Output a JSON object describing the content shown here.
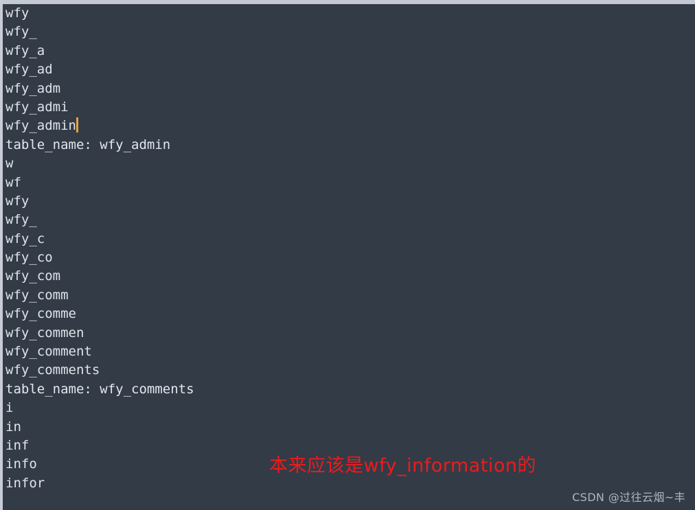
{
  "window": {
    "background_color": "#333b47",
    "chrome_color": "#c5c9d4",
    "text_color": "#dfe4ea",
    "caret_color": "#e8a33d",
    "annotation_color": "#ec1c1c",
    "watermark_color": "#aeb6c2"
  },
  "terminal": {
    "lines": [
      {
        "text": "wfy",
        "kind": "typed"
      },
      {
        "text": "wfy_",
        "kind": "typed"
      },
      {
        "text": "wfy_a",
        "kind": "typed"
      },
      {
        "text": "wfy_ad",
        "kind": "typed"
      },
      {
        "text": "wfy_adm",
        "kind": "typed"
      },
      {
        "text": "wfy_admi",
        "kind": "typed"
      },
      {
        "text": "wfy_admin",
        "kind": "typed",
        "caret": true
      },
      {
        "text": "table_name: wfy_admin",
        "kind": "output"
      },
      {
        "text": "w",
        "kind": "typed"
      },
      {
        "text": "wf",
        "kind": "typed"
      },
      {
        "text": "wfy",
        "kind": "typed"
      },
      {
        "text": "wfy_",
        "kind": "typed"
      },
      {
        "text": "wfy_c",
        "kind": "typed"
      },
      {
        "text": "wfy_co",
        "kind": "typed"
      },
      {
        "text": "wfy_com",
        "kind": "typed"
      },
      {
        "text": "wfy_comm",
        "kind": "typed"
      },
      {
        "text": "wfy_comme",
        "kind": "typed"
      },
      {
        "text": "wfy_commen",
        "kind": "typed"
      },
      {
        "text": "wfy_comment",
        "kind": "typed"
      },
      {
        "text": "wfy_comments",
        "kind": "typed"
      },
      {
        "text": "table_name: wfy_comments",
        "kind": "output"
      },
      {
        "text": "i",
        "kind": "typed"
      },
      {
        "text": "in",
        "kind": "typed"
      },
      {
        "text": "inf",
        "kind": "typed"
      },
      {
        "text": "info",
        "kind": "typed"
      },
      {
        "text": "infor",
        "kind": "typed"
      }
    ]
  },
  "annotation": {
    "text": "本来应该是wfy_information的"
  },
  "watermark": {
    "text": "CSDN @过往云烟~丰"
  }
}
